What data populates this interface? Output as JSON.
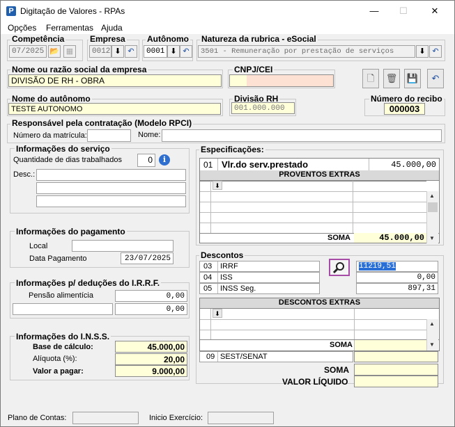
{
  "window": {
    "title": "Digitação de Valores - RPAs",
    "app_icon": "P",
    "minimize": "—",
    "maximize": "☐",
    "close": "✕"
  },
  "menu": [
    "Opções",
    "Ferramentas",
    "Ajuda"
  ],
  "competencia": {
    "label": "Competência",
    "value": "07/2025"
  },
  "empresa": {
    "label": "Empresa",
    "value": "0012"
  },
  "autonomo": {
    "label": "Autônomo",
    "value": "0001"
  },
  "natureza": {
    "label": "Natureza da rubrica - eSocial",
    "value": "3501 - Remuneração por prestação de serviços"
  },
  "empresa_nome": {
    "label": "Nome ou razão social da empresa",
    "value": "DIVISÃO DE RH - OBRA"
  },
  "cnpj": {
    "label": "CNPJ/CEI",
    "value": ""
  },
  "autonomo_nome": {
    "label": "Nome do autônomo",
    "value": "TESTE AUTONOMO"
  },
  "divisao_rh": {
    "label": "Divisão RH",
    "value": "001.000.000"
  },
  "recibo": {
    "label": "Número do recibo",
    "value": "000003"
  },
  "responsavel": {
    "title": "Responsável pela contratação (Modelo RPCI)",
    "matricula_label": "Número da matrícula:",
    "matricula": "",
    "nome_label": "Nome:",
    "nome": ""
  },
  "servico": {
    "title": "Informações do serviço",
    "dias_label": "Quantidade de dias trabalhados",
    "dias": "0",
    "desc_label": "Desc.:",
    "desc_lines": [
      "",
      "",
      ""
    ]
  },
  "pagamento": {
    "title": "Informações do pagamento",
    "local_label": "Local",
    "local": "",
    "data_label": "Data Pagamento",
    "data": "23/07/2025"
  },
  "irrf_deducoes": {
    "title": "Informações p/ deduções do I.R.R.F.",
    "pensao_label": "Pensão alimentícia",
    "pensao": "0,00",
    "outro_label": "",
    "outro": "0,00"
  },
  "inss": {
    "title": "Informações do I.N.S.S.",
    "base_label": "Base de cálculo:",
    "base": "45.000,00",
    "aliquota_label": "Alíquota (%):",
    "aliquota": "20,00",
    "valor_label": "Valor a pagar:",
    "valor": "9.000,00"
  },
  "especificacoes": {
    "title": "Especificações:",
    "code": "01",
    "desc": "Vlr.do serv.prestado",
    "value": "45.000,00",
    "proventos_header": "PROVENTOS EXTRAS",
    "soma_label": "SOMA",
    "soma": "45.000,00"
  },
  "descontos": {
    "title": "Descontos",
    "items": [
      {
        "code": "03",
        "name": "IRRF",
        "value": "11219,51"
      },
      {
        "code": "04",
        "name": "ISS",
        "value": "0,00"
      },
      {
        "code": "05",
        "name": "INSS Seg.",
        "value": "897,31"
      }
    ],
    "extras_header": "DESCONTOS EXTRAS",
    "soma_label": "SOMA",
    "soma": "",
    "sest_code": "09",
    "sest_name": "SEST/SENAT",
    "sest_value": "",
    "total_soma_label": "SOMA",
    "total_soma": "",
    "liquido_label": "VALOR LÍQUIDO",
    "liquido": ""
  },
  "status": {
    "plano_label": "Plano de Contas:",
    "plano": "",
    "inicio_label": "Inicio Exercício:",
    "inicio": ""
  }
}
